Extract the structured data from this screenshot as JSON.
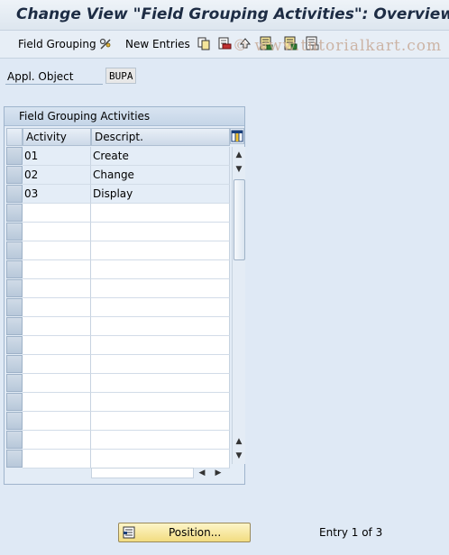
{
  "title": "Change View \"Field Grouping Activities\": Overview",
  "toolbar": {
    "field_grouping": "Field Grouping",
    "new_entries": "New Entries",
    "icons": [
      "edit-glasses-icon",
      "copy-icon",
      "delete-icon",
      "undo-icon",
      "select-all-icon",
      "select-block-icon",
      "deselect-all-icon"
    ]
  },
  "watermark": "© www.tutorialkart.com",
  "header": {
    "label": "Appl. Object",
    "value": "BUPA"
  },
  "table": {
    "title": "Field Grouping Activities",
    "columns": [
      "Activity",
      "Descript."
    ],
    "rows": [
      {
        "activity": "01",
        "description": "Create"
      },
      {
        "activity": "02",
        "description": "Change"
      },
      {
        "activity": "03",
        "description": "Display"
      }
    ],
    "total_visible_rows": 17
  },
  "footer": {
    "position_button": "Position...",
    "entry_text": "Entry 1 of 3"
  },
  "colors": {
    "background": "#dfe9f5",
    "button_yellow": "#f2dc80",
    "title_text": "#1d2c44"
  }
}
